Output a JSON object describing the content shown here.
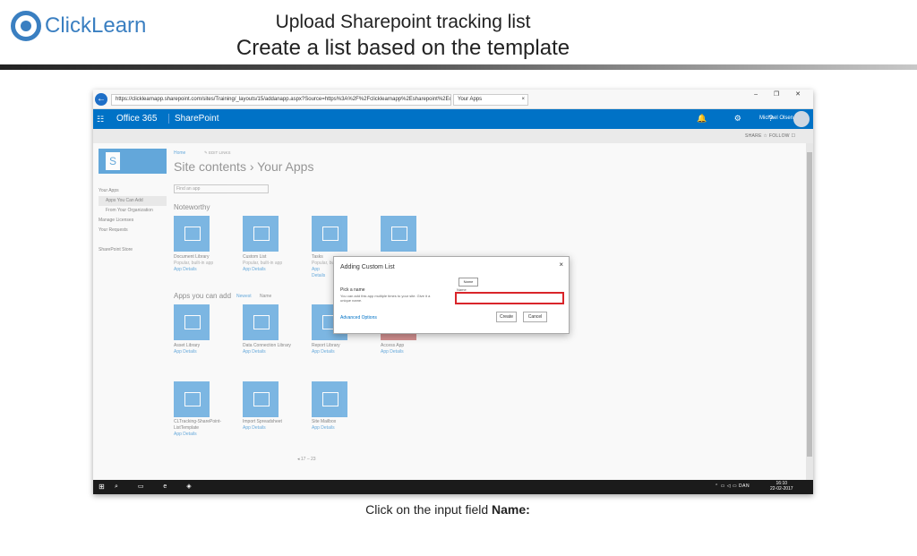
{
  "brand": {
    "logo_text": "ClickLearn"
  },
  "slide": {
    "title_line1": "Upload Sharepoint tracking list",
    "title_line2": "Create a list based on the template",
    "caption_prefix": "Click on the input field ",
    "caption_bold": "Name:"
  },
  "browser": {
    "back_icon": "←",
    "url": "https://clicklearnapp.sharepoint.com/sites/Training/_layouts/15/addanapp.aspx?Source=https%3A%2F%2Fclicklearnapp%2Esharepoint%2Ecom%2Fsit",
    "tab_title": "Your Apps",
    "tab_close": "×",
    "window_controls": "– ❐ ✕"
  },
  "suite": {
    "waffle_icon": "☷",
    "office_label": "Office 365",
    "app_label": "SharePoint",
    "icons": "🔔 ⚙ ?",
    "user_name": "Michael Olsen"
  },
  "subbar": {
    "share_follow": "SHARE ☆ FOLLOW ☐"
  },
  "page": {
    "crumb_home": "Home",
    "crumb_edit": "✎ EDIT LINKS",
    "title": "Site contents › Your Apps",
    "find_placeholder": "Find an app",
    "noteworthy": "Noteworthy",
    "apps_you_can_add": "Apps you can add",
    "sort_newest": "Newest",
    "sort_name": "Name",
    "pager": "◂  17 – 23"
  },
  "leftnav": {
    "items": [
      "Your Apps",
      "Apps You Can Add",
      "From Your Organization",
      "Manage Licenses",
      "Your Requests",
      "",
      "SharePoint Store"
    ]
  },
  "tiles": [
    {
      "name": "Document Library",
      "sub": "Popular, built-in app",
      "link": "App Details"
    },
    {
      "name": "Custom List",
      "sub": "Popular, built-in app",
      "link": "App Details"
    },
    {
      "name": "Tasks",
      "sub": "Popular, built-in app",
      "link": "App Details"
    },
    {
      "name": "Asset Library",
      "sub": "",
      "link": "App Details"
    },
    {
      "name": "Data Connection Library",
      "sub": "",
      "link": "App Details"
    },
    {
      "name": "Report Library",
      "sub": "",
      "link": "App Details"
    },
    {
      "name": "Access App",
      "sub": "",
      "link": "App Details"
    },
    {
      "name": "CLTracking-SharePoint-ListTemplate",
      "sub": "",
      "link": "App Details"
    },
    {
      "name": "Import Spreadsheet",
      "sub": "",
      "link": "App Details"
    },
    {
      "name": "Site Mailbox",
      "sub": "",
      "link": "App Details"
    }
  ],
  "dialog": {
    "title": "Adding Custom List",
    "close": "×",
    "pick_label": "Pick a name",
    "pick_desc": "You can add this app multiple times to your site. Give it a unique name.",
    "tooltip": "Name",
    "name_label": "Name",
    "name_value": "",
    "advanced": "Advanced Options",
    "create": "Create",
    "cancel": "Cancel"
  },
  "taskbar": {
    "start_icon": "⊞",
    "icons": "⌕ ▭ e ◈",
    "tray": "⌃ ▭ ◁ ▭ DAN",
    "time": "16:10",
    "date": "22-02-2017"
  }
}
